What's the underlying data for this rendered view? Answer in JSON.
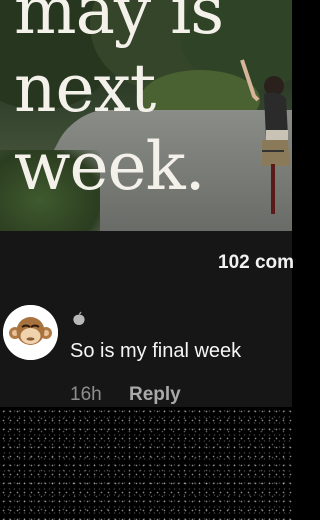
{
  "post": {
    "overlay_lines": [
      "may is",
      "next",
      "week."
    ]
  },
  "comments": {
    "count_label": "102 com"
  },
  "comment": {
    "avatar": "monkey-face-avatar",
    "badge_icon": "peach-icon",
    "text": "So is my final week",
    "time": "16h",
    "reply_label": "Reply"
  },
  "colors": {
    "overlay_text": "#f4f1ea",
    "comment_bg": "#161617",
    "meta_text": "#8e8e8e"
  }
}
